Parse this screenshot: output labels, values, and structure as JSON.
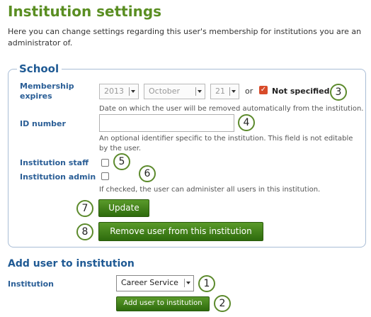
{
  "page": {
    "title": "Institution settings",
    "intro": "Here you can change settings regarding this user's membership for institutions you are an administrator of."
  },
  "school": {
    "legend": "School",
    "membership_label": "Membership expires",
    "year": "2013",
    "month": "October",
    "day": "21",
    "or_text": "or",
    "not_specified_label": "Not specified",
    "not_specified_checked": true,
    "membership_desc": "Date on which the user will be removed automatically from the institution.",
    "id_label": "ID number",
    "id_value": "",
    "id_desc": "An optional identifier specific to the institution. This field is not editable by the user.",
    "staff_label": "Institution staff",
    "staff_checked": false,
    "admin_label": "Institution admin",
    "admin_checked": false,
    "admin_desc": "If checked, the user can administer all users in this institution.",
    "update_button": "Update",
    "remove_button": "Remove user from this institution"
  },
  "add_user": {
    "title": "Add user to institution",
    "institution_label": "Institution",
    "institution_value": "Career Service",
    "add_button": "Add user to institution"
  },
  "callouts": [
    "1",
    "2",
    "3",
    "4",
    "5",
    "6",
    "7",
    "8"
  ],
  "colors": {
    "title_green": "#5a8e22",
    "label_blue": "#2a5e96",
    "button_green": "#2e6b0d",
    "checkbox_checked": "#d84b2a"
  }
}
